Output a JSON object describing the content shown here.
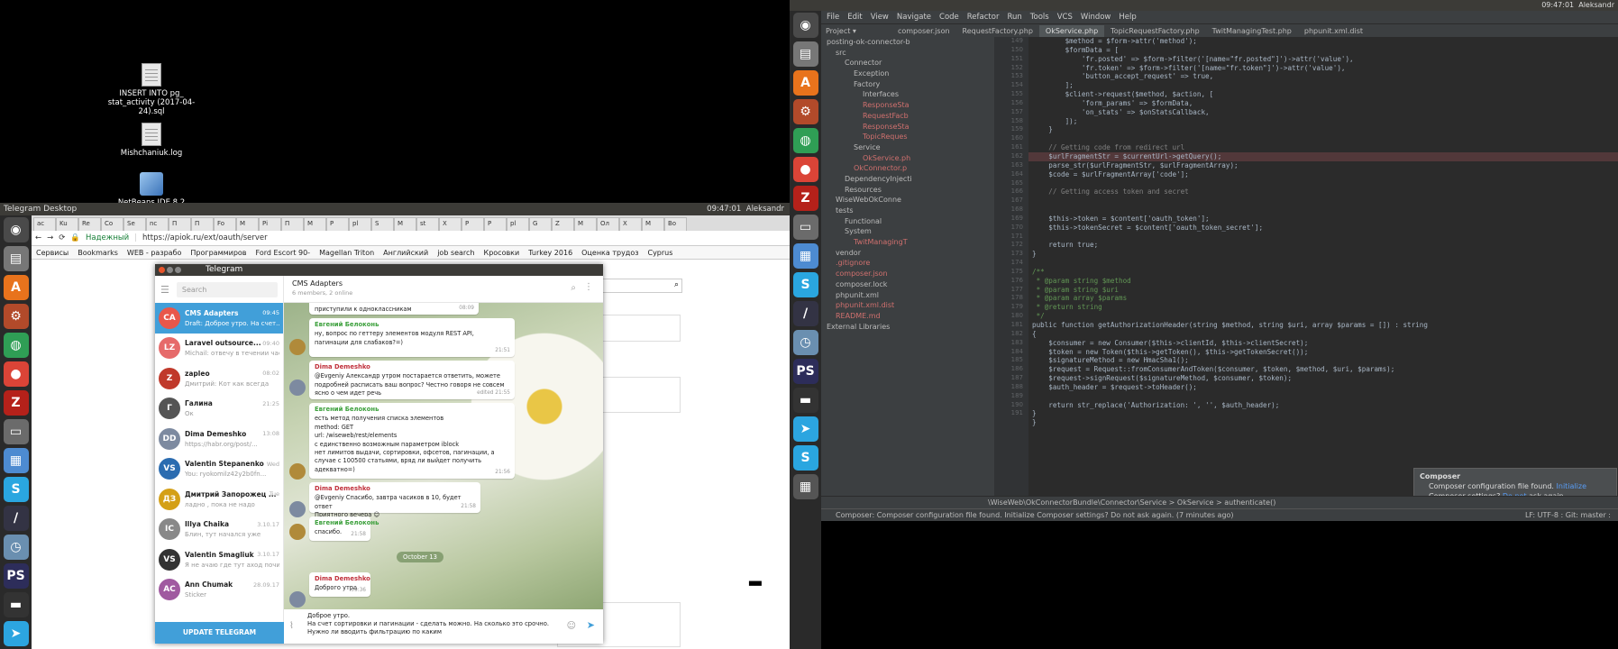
{
  "desktop": {
    "icons": [
      {
        "label": "INSERT INTO pg_ stat_activity (2017-04-24).sql"
      },
      {
        "label": "Mishchaniuk.log"
      },
      {
        "label": "NetBeans IDE 8.2"
      }
    ]
  },
  "left_panel": {
    "title": "Telegram Desktop",
    "clock": "09:47:01",
    "user": "Aleksandr"
  },
  "chrome": {
    "tabs": [
      "ac",
      "Ku",
      "Re",
      "Co",
      "Se",
      "nc",
      "П",
      "П",
      "Fo",
      "М",
      "Pi",
      "П",
      "М",
      "Р",
      "pl",
      "S",
      "М",
      "st",
      "Х",
      "Р",
      "Р",
      "pl",
      "G",
      "Z",
      "М",
      "Ол",
      "Х",
      "М",
      "Bo"
    ],
    "url": "https://apiok.ru/ext/oauth/server",
    "secure": "Надежный",
    "bookmarks": [
      "Сервисы",
      "Bookmarks",
      "WEB - разрабо",
      "Программиров",
      "Ford Escort 90-",
      "Magellan Triton",
      "Английский",
      "job search",
      "Кросовки",
      "Turkey 2016",
      "Оценка трудоз",
      "Cyprus"
    ]
  },
  "telegram": {
    "title": "Telegram",
    "search_placeholder": "Search",
    "update_label": "UPDATE TELEGRAM",
    "chats": [
      {
        "initials": "CA",
        "name": "CMS Adapters",
        "time": "09:45",
        "preview": "Draft: Доброе утро. На счет..."
      },
      {
        "initials": "LZ",
        "name": "Laravel outsource...",
        "time": "09:40",
        "preview": "Michail: отвечу в течении часа"
      },
      {
        "initials": "Z",
        "name": "zapleo",
        "time": "08:02",
        "preview": "Дмитрий: Кот как всегда"
      },
      {
        "initials": "Г",
        "name": "Галина",
        "time": "21:25",
        "preview": "Ок"
      },
      {
        "initials": "DD",
        "name": "Dima Demeshko",
        "time": "13:08",
        "preview": "https://habr.org/post/..."
      },
      {
        "initials": "VS",
        "name": "Valentin Stepanenko",
        "time": "Wed",
        "preview": "You: ryokomilz42y2b0fn..."
      },
      {
        "initials": "ДЗ",
        "name": "Дмитрий Запорожец ...",
        "time": "Tue",
        "preview": "ладно , пока не надо"
      },
      {
        "initials": "IC",
        "name": "Illya Chaika",
        "time": "3.10.17",
        "preview": "Блин, тут начался уже"
      },
      {
        "initials": "VS",
        "name": "Valentin Smagliuk",
        "time": "3.10.17",
        "preview": "Я не ачаю где тут аход почи..."
      },
      {
        "initials": "AC",
        "name": "Ann Chumak",
        "time": "28.09.17",
        "preview": "Sticker"
      }
    ],
    "header": {
      "name": "CMS Adapters",
      "sub": "6 members, 2 online"
    },
    "messages": [
      {
        "author": "",
        "text": "приступили к одноклассникам",
        "time": "08:09"
      },
      {
        "author": "Евгений Белоконь",
        "text": "ну, вопрос по геттеру элементов модуля REST API, пагинации для слабаков?=)",
        "time": "21:51"
      },
      {
        "author": "Dima Demeshko",
        "text": "@Evgeniy Александр утром постарается ответить, можете подробней расписать ваш вопрос? Честно говоря не совсем ясно о чем идет речь",
        "time": "edited 21:55"
      },
      {
        "author": "Евгений Белоконь",
        "text": "есть метод получения списка элементов\nmethod: GET\nurl: /wiseweb/rest/elements\nс единственно возможным параметром iblock\nнет лимитов выдачи, сортировки, офсетов, пагинации, а\nслучае с 100500 статьями, вряд ли выйдет получить\nадекватно=)",
        "time": "21:56"
      },
      {
        "author": "Dima Demeshko",
        "text": "@Evgeniy Спасибо, завтра часиков в 10, будет ответ\nПриятного вечера 😊",
        "time": "21:58"
      },
      {
        "author": "Евгений Белоконь",
        "text": "спасибо.",
        "time": "21:58"
      },
      {
        "author": "Dima Demeshko",
        "text": "Доброго утра",
        "time": "09:36"
      }
    ],
    "date_badge": "October 13",
    "compose_lines": [
      "Доброе утро.",
      "На счет сортировки и пагинации - сделать можно. На сколько это срочно.",
      "Нужно ли вводить фильтрацию по каким"
    ]
  },
  "ide": {
    "topbar": {
      "clock": "09:47:01",
      "user": "Aleksandr"
    },
    "menu": [
      "File",
      "Edit",
      "View",
      "Navigate",
      "Code",
      "Refactor",
      "Run",
      "Tools",
      "VCS",
      "Window",
      "Help"
    ],
    "project_label": "Project",
    "editor_tabs": [
      "composer.json",
      "RequestFactory.php",
      "OkService.php",
      "TopicRequestFactory.php",
      "TwitManagingTest.php",
      "phpunit.xml.dist"
    ],
    "active_tab": "OkService.php",
    "tree": [
      "posting-ok-connector-b",
      "src",
      "Connector",
      "Exception",
      "Factory",
      "Interfaces",
      "ResponseSta",
      "RequestFacb",
      "ResponseSta",
      "TopicReques",
      "Service",
      "OkService.ph",
      "OkConnector.p",
      "DependencyInjecti",
      "Resources",
      "WiseWebOkConne",
      "tests",
      "Functional",
      "System",
      "TwitManagingT",
      "vendor",
      ".gitignore",
      "composer.json",
      "composer.lock",
      "phpunit.xml",
      "phpunit.xml.dist",
      "README.md",
      "External Libraries"
    ],
    "line_numbers": [
      "149",
      "150",
      "151",
      "152",
      "153",
      "154",
      "155",
      "156",
      "157",
      "158",
      "159",
      "160",
      "161",
      "162",
      "163",
      "164",
      "165",
      "166",
      "167",
      "168",
      "169",
      "170",
      "171",
      "172",
      "173",
      "174",
      "175",
      "176",
      "177",
      "178",
      "179",
      "180",
      "181",
      "182",
      "183",
      "184",
      "185",
      "186",
      "187",
      "188",
      "189",
      "190",
      "191"
    ],
    "code": [
      "        $method = $form->attr('method');",
      "        $formData = [",
      "            'fr.posted' => $form->filter('[name=\"fr.posted\"]')->attr('value'),",
      "            'fr.token' => $form->filter('[name=\"fr.token\"]')->attr('value'),",
      "            'button_accept_request' => true,",
      "        ];",
      "        $client->request($method, $action, [",
      "            'form_params' => $formData,",
      "            'on_stats' => $onStatsCallback,",
      "        ]);",
      "    }",
      "",
      "    // Getting code from redirect url",
      "    $urlFragmentStr = $currentUrl->getQuery();",
      "    parse_str($urlFragmentStr, $urlFragmentArray);",
      "    $code = $urlFragmentArray['code'];",
      "",
      "    // Getting access token and secret",
      "",
      "",
      "    $this->token = $content['oauth_token'];",
      "    $this->tokenSecret = $content['oauth_token_secret'];",
      "",
      "    return true;",
      "}",
      "",
      "/**",
      " * @param string $method",
      " * @param string $uri",
      " * @param array $params",
      " * @return string",
      " */",
      "public function getAuthorizationHeader(string $method, string $uri, array $params = []) : string",
      "{",
      "    $consumer = new Consumer($this->clientId, $this->clientSecret);",
      "    $token = new Token($this->getToken(), $this->getTokenSecret());",
      "    $signatureMethod = new HmacSha1();",
      "    $request = Request::fromConsumerAndToken($consumer, $token, $method, $uri, $params);",
      "    $request->signRequest($signatureMethod, $consumer, $token);",
      "    $auth_header = $request->toHeader();",
      "",
      "    return str_replace('Authorization: ', '', $auth_header);",
      "}",
      "}"
    ],
    "breadcrumbs": "\\WiseWeb\\OkConnectorBundle\\Connector\\Service  >  OkService  >  authenticate()",
    "notification": {
      "title": "Composer",
      "line1": "Composer configuration file found.",
      "link1": "Initialize",
      "line2": "Composer settings?",
      "link2": "Do not",
      "line2b": "ask again."
    },
    "status": "Composer: Composer configuration file found. Initialize Composer settings? Do not ask again. (7 minutes ago)",
    "status_right": "LF:  UTF-8 :  Git: master :"
  }
}
